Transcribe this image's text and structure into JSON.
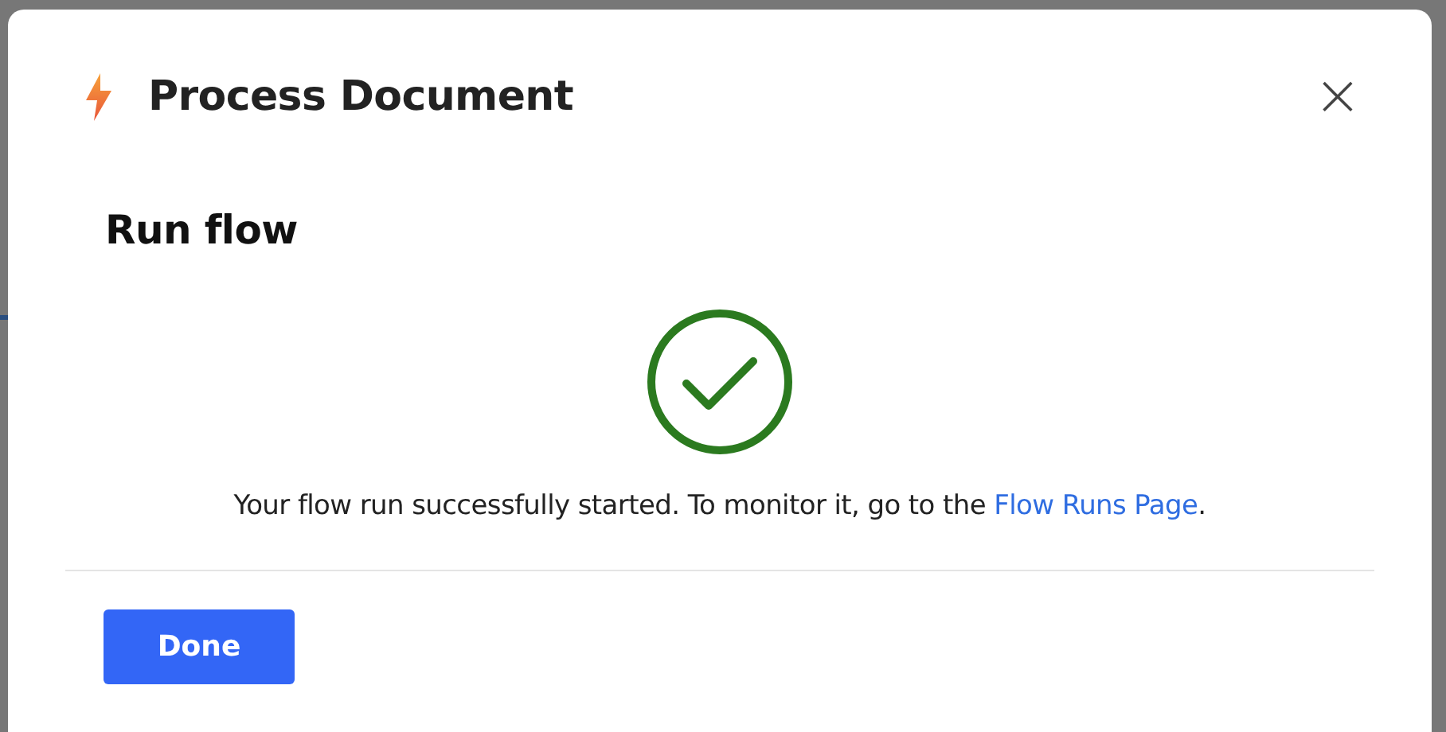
{
  "dialog": {
    "title": "Process Document",
    "close_label": "×",
    "heading": "Run flow",
    "message": {
      "text": "Your flow run successfully started. To monitor it, go to the ",
      "link": "Flow Runs Page",
      "end": "."
    },
    "buttons": [
      {
        "label": "Done",
        "kind": "primary"
      }
    ]
  }
}
